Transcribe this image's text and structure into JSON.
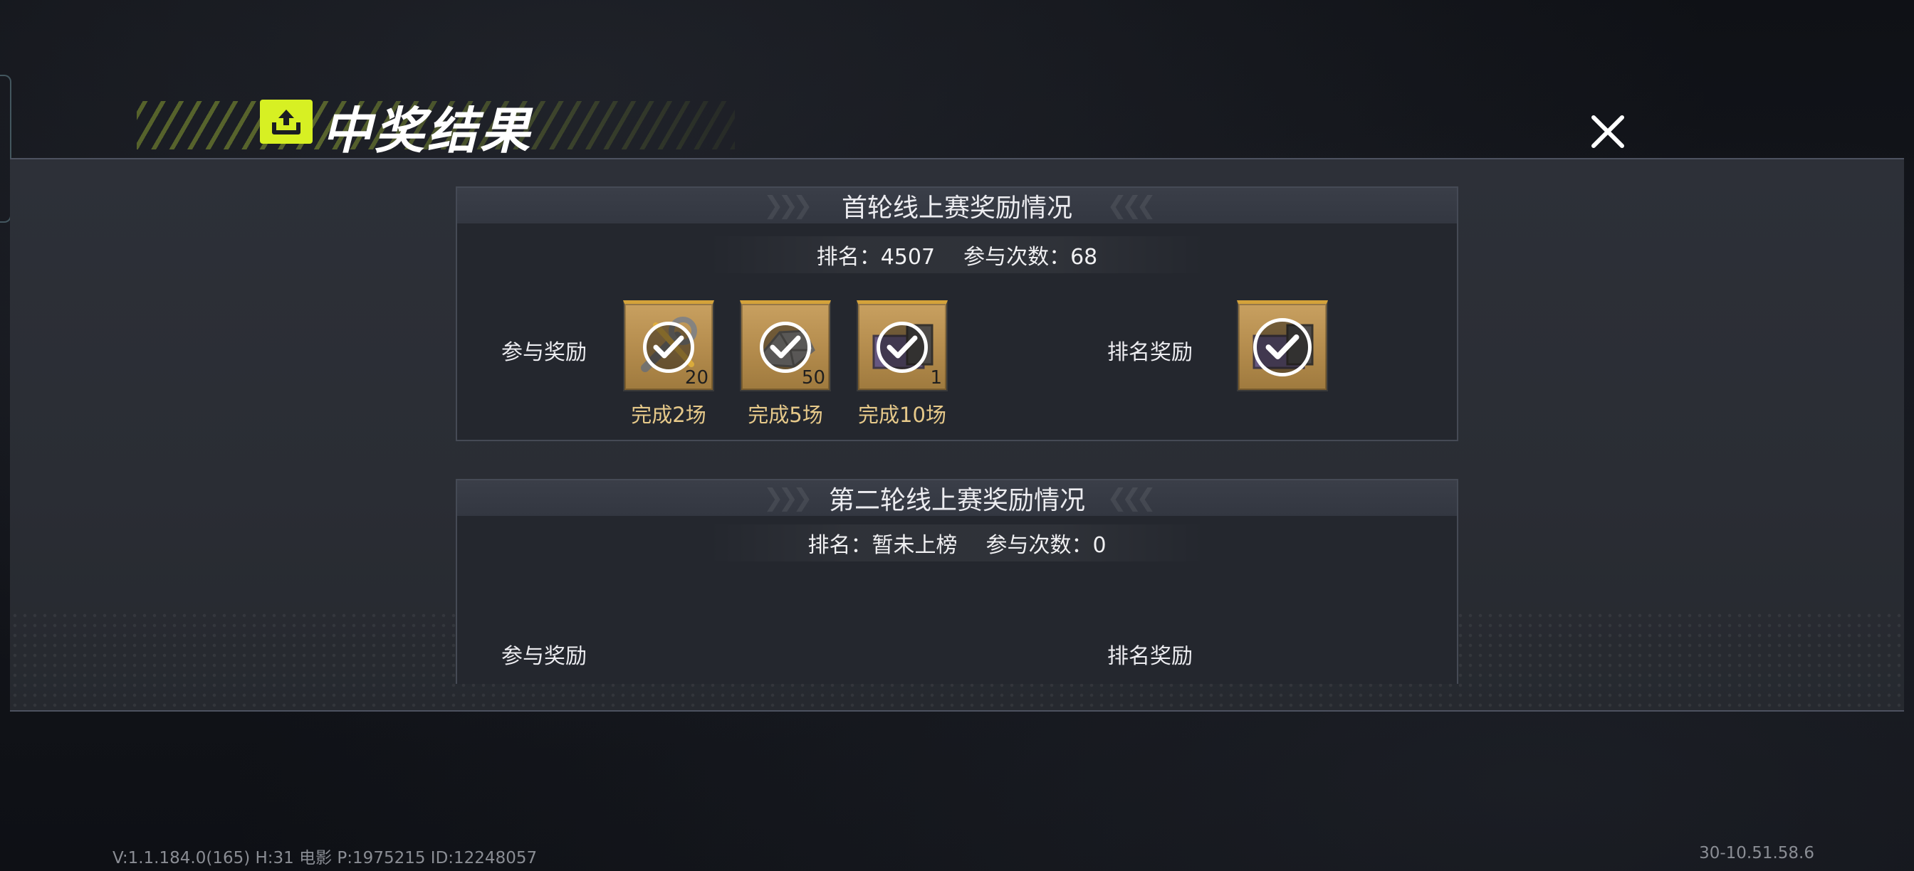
{
  "header": {
    "title": "中奖结果",
    "badge_icon": "upload-box-icon",
    "close_icon": "close-icon",
    "accent_color": "#d7f023"
  },
  "round1": {
    "title": "首轮线上赛奖励情况",
    "rank_label": "排名：4507",
    "participation_label": "参与次数：68",
    "participation_reward_label": "参与奖励",
    "rank_reward_label": "排名奖励",
    "participation_rewards": [
      {
        "icon": "wrench-parts-icon",
        "count": "20",
        "condition": "完成2场",
        "claimed": true
      },
      {
        "icon": "silver-ore-icon",
        "count": "50",
        "condition": "完成5场",
        "claimed": true
      },
      {
        "icon": "weapon-case-icon",
        "count": "1",
        "condition": "完成10场",
        "claimed": true
      }
    ],
    "rank_rewards": [
      {
        "icon": "weapon-case-icon",
        "count": "",
        "claimed": true
      }
    ]
  },
  "round2": {
    "title": "第二轮线上赛奖励情况",
    "rank_label": "排名：暂未上榜",
    "participation_label": "参与次数：0",
    "participation_reward_label": "参与奖励",
    "rank_reward_label": "排名奖励"
  },
  "footer": {
    "version": "V:1.1.184.0(165) H:31 电影 P:1975215 ID:12248057",
    "build": "30-10.51.58.6"
  }
}
